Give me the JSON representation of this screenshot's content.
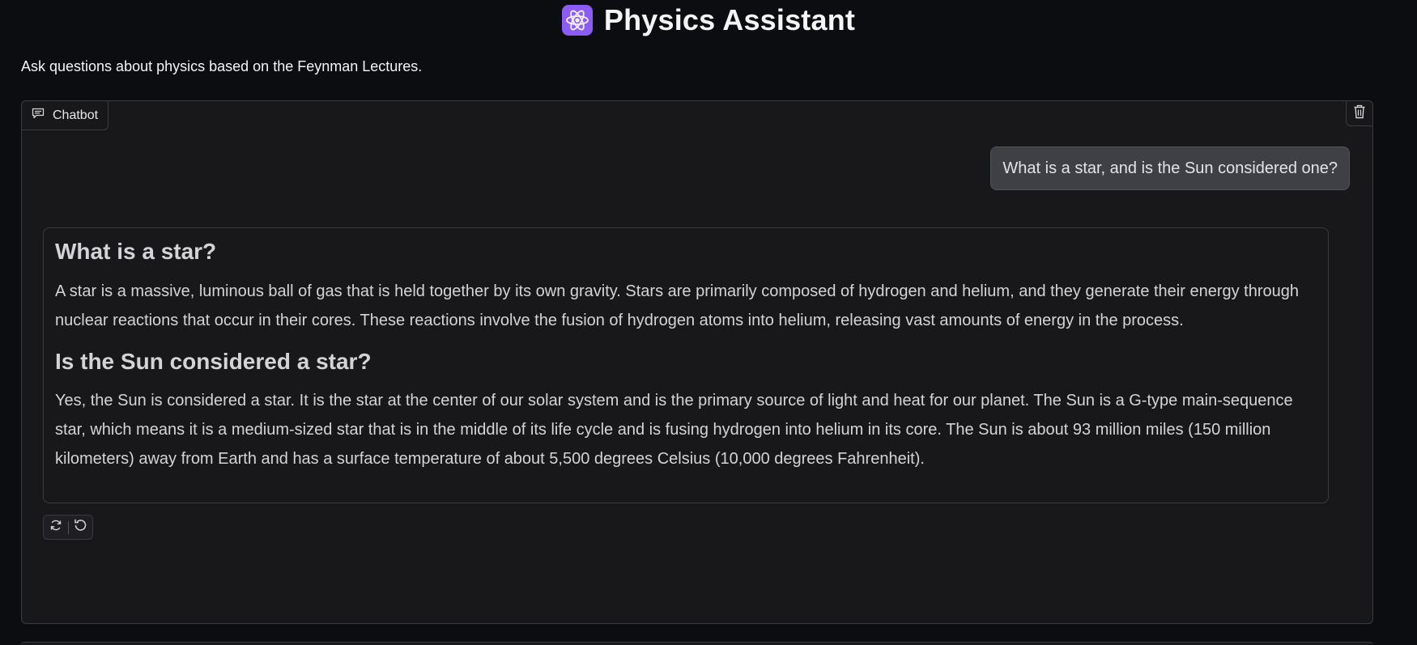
{
  "app": {
    "title": "Physics Assistant",
    "subtitle": "Ask questions about physics based on the Feynman Lectures.",
    "icon": "atom-icon"
  },
  "chatbot": {
    "label": "Chatbot",
    "label_icon": "chat-bubble-icon",
    "clear_icon": "trash-icon"
  },
  "messages": {
    "user": "What is a star, and is the Sun considered one?",
    "bot": {
      "heading_1": "What is a star?",
      "paragraph_1": "A star is a massive, luminous ball of gas that is held together by its own gravity. Stars are primarily composed of hydrogen and helium, and they generate their energy through nuclear reactions that occur in their cores. These reactions involve the fusion of hydrogen atoms into helium, releasing vast amounts of energy in the process.",
      "heading_2": "Is the Sun considered a star?",
      "paragraph_2": "Yes, the Sun is considered a star. It is the star at the center of our solar system and is the primary source of light and heat for our planet. The Sun is a G-type main-sequence star, which means it is a medium-sized star that is in the middle of its life cycle and is fusing hydrogen into helium in its core. The Sun is about 93 million miles (150 million kilometers) away from Earth and has a surface temperature of about 5,500 degrees Celsius (10,000 degrees Fahrenheit)."
    }
  },
  "actions": {
    "retry_icon": "retry-icon",
    "undo_icon": "undo-icon"
  },
  "colors": {
    "background": "#0c0d10",
    "panel": "#18181b",
    "border": "#3a3b40",
    "user_bubble": "#3f3f46",
    "accent": "#8b5cf6"
  }
}
